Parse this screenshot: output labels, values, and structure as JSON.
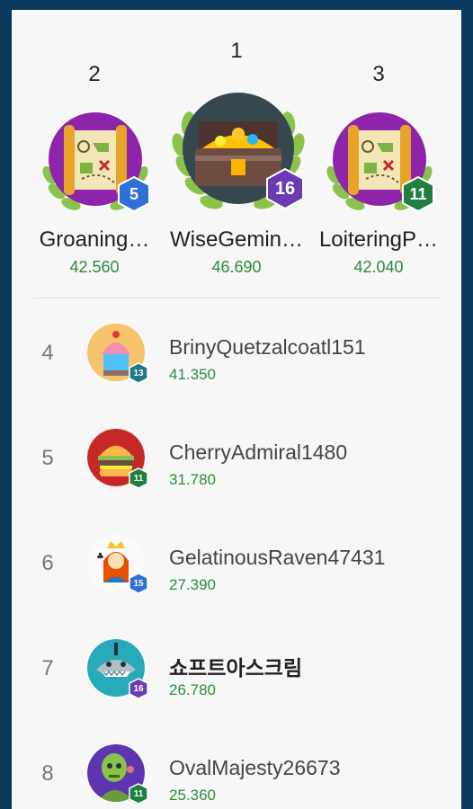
{
  "podium": [
    {
      "rank": "2",
      "name": "Groaning…",
      "score": "42.560",
      "level": "5",
      "badge_color": "#2f6fd8",
      "avatar": "treasure-map-icon"
    },
    {
      "rank": "1",
      "name": "WiseGemin…",
      "score": "46.690",
      "level": "16",
      "badge_color": "#6a3bb5",
      "avatar": "treasure-chest-icon"
    },
    {
      "rank": "3",
      "name": "LoiteringP…",
      "score": "42.040",
      "level": "11",
      "badge_color": "#1f7f3f",
      "avatar": "treasure-map-icon"
    }
  ],
  "list": [
    {
      "rank": "4",
      "name": "BrinyQuetzalcoatl151",
      "score": "41.350",
      "level": "13",
      "badge_color": "#1f7a84",
      "avatar": "cupcake-icon"
    },
    {
      "rank": "5",
      "name": "CherryAdmiral1480",
      "score": "31.780",
      "level": "11",
      "badge_color": "#1f7f3f",
      "avatar": "burger-icon"
    },
    {
      "rank": "6",
      "name": "GelatinousRaven47431",
      "score": "27.390",
      "level": "15",
      "badge_color": "#2f6fd8",
      "avatar": "queen-card-icon"
    },
    {
      "rank": "7",
      "name": "쇼프트아스크림",
      "score": "26.780",
      "level": "16",
      "badge_color": "#6a3bb5",
      "avatar": "shark-icon"
    },
    {
      "rank": "8",
      "name": "OvalMajesty26673",
      "score": "25.360",
      "level": "11",
      "badge_color": "#1f7f3f",
      "avatar": "zombie-icon"
    }
  ]
}
